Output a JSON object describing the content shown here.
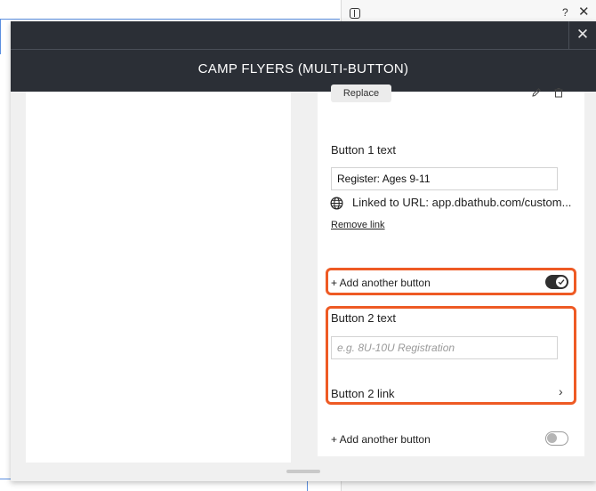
{
  "modal": {
    "title": "CAMP FLYERS (MULTI-BUTTON)",
    "close_glyph": "✕"
  },
  "background": {
    "help_glyph": "?",
    "close_glyph": "✕"
  },
  "settings": {
    "replace_label": "Replace",
    "button1": {
      "label": "Button 1 text",
      "value": "Register: Ages 9-11",
      "linked_text": "Linked to URL: app.dbathub.com/custom...",
      "remove_link": "Remove link"
    },
    "add_another_1": {
      "label": "+ Add another button",
      "enabled": true
    },
    "button2": {
      "label": "Button 2 text",
      "placeholder": "e.g. 8U-10U Registration",
      "link_label": "Button 2 link",
      "chevron": "›"
    },
    "add_another_2": {
      "label": "+ Add another button",
      "enabled": false
    }
  },
  "colors": {
    "highlight": "#ee5a24",
    "header": "#2b2f36",
    "toggle_on": "#2f2f2f"
  },
  "icons": [
    "globe-icon",
    "pencil-icon",
    "trash-icon",
    "check-icon",
    "chevron-right-icon",
    "close-icon",
    "help-icon"
  ]
}
